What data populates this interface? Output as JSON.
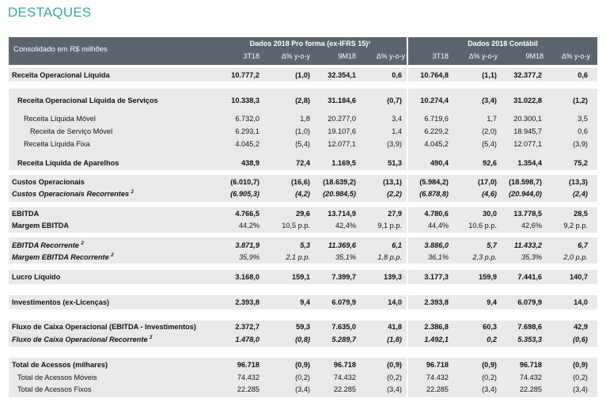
{
  "title": "DESTAQUES",
  "header": {
    "left_label": "Consolidado em R$ milhões",
    "group_proforma": "Dados 2018 Pro forma (ex-IFRS 15)¹",
    "group_contabil": "Dados 2018 Contábil",
    "columns": [
      "3T18",
      "∆% y-o-y",
      "9M18",
      "∆% y-o-y",
      "3T18",
      "∆% y-o-y",
      "9M18",
      "∆% y-o-y"
    ]
  },
  "rows": [
    {
      "label": "Receita Operacional Líquida",
      "values": [
        "10.777,2",
        "(1,0)",
        "32.354,1",
        "0,6",
        "10.764,8",
        "(1,1)",
        "32.377,2",
        "0,6"
      ]
    },
    {
      "label": "Receita Operacional Líquida de Serviços",
      "values": [
        "10.338,3",
        "(2,8)",
        "31.184,6",
        "(0,7)",
        "10.274,4",
        "(3,4)",
        "31.022,8",
        "(1,2)"
      ]
    },
    {
      "label": "Receita Líquida Móvel",
      "values": [
        "6.732,0",
        "1,8",
        "20.277,0",
        "3,4",
        "6.719,6",
        "1,7",
        "20.300,1",
        "3,5"
      ]
    },
    {
      "label": "Receita de Serviço Móvel",
      "values": [
        "6.293,1",
        "(1,0)",
        "19.107,6",
        "1,4",
        "6.229,2",
        "(2,0)",
        "18.945,7",
        "0,6"
      ]
    },
    {
      "label": "Receita Líquida Fixa",
      "values": [
        "4.045,2",
        "(5,4)",
        "12.077,1",
        "(3,9)",
        "4.045,2",
        "(5,4)",
        "12.077,1",
        "(3,9)"
      ]
    },
    {
      "label": "Receita Líquida de Aparelhos",
      "values": [
        "438,9",
        "72,4",
        "1.169,5",
        "51,3",
        "490,4",
        "92,6",
        "1.354,4",
        "75,2"
      ]
    },
    {
      "label": "Custos Operacionais",
      "values": [
        "(6.010,7)",
        "(16,6)",
        "(18.639,2)",
        "(13,1)",
        "(5.984,2)",
        "(17,0)",
        "(18.598,7)",
        "(13,3)"
      ]
    },
    {
      "label": "Custos Operacionais Recorrentes",
      "sup": "2",
      "values": [
        "(6.905,3)",
        "(4,2)",
        "(20.984,5)",
        "(2,2)",
        "(6.878,8)",
        "(4,6)",
        "(20.944,0)",
        "(2,4)"
      ]
    },
    {
      "label": "EBITDA",
      "values": [
        "4.766,5",
        "29,6",
        "13.714,9",
        "27,9",
        "4.780,6",
        "30,0",
        "13.778,5",
        "28,5"
      ]
    },
    {
      "label": "Margem EBITDA",
      "values": [
        "44,2%",
        "10,5 p.p.",
        "42,4%",
        "9,1 p.p.",
        "44,4%",
        "10,6 p.p.",
        "42,6%",
        "9,2 p.p."
      ]
    },
    {
      "label": "EBITDA Recorrente",
      "sup": "2",
      "values": [
        "3.871,9",
        "5,3",
        "11.369,6",
        "6,1",
        "3.886,0",
        "5,7",
        "11.433,2",
        "6,7"
      ]
    },
    {
      "label": "Margem EBITDA Recorrente",
      "sup": "2",
      "values": [
        "35,9%",
        "2,1 p.p.",
        "35,1%",
        "1,8 p.p.",
        "36,1%",
        "2,3 p.p.",
        "35,3%",
        "2,0 p.p."
      ]
    },
    {
      "label": "Lucro Líquido",
      "values": [
        "3.168,0",
        "159,1",
        "7.399,7",
        "139,3",
        "3.177,3",
        "159,9",
        "7.441,6",
        "140,7"
      ]
    },
    {
      "label": "Investimentos (ex-Licenças)",
      "values": [
        "2.393,8",
        "9,4",
        "6.079,9",
        "14,0",
        "2.393,8",
        "9,4",
        "6.079,9",
        "14,0"
      ]
    },
    {
      "label": "Fluxo de Caixa Operacional (EBITDA - Investimentos)",
      "values": [
        "2.372,7",
        "59,3",
        "7.635,0",
        "41,8",
        "2.386,8",
        "60,3",
        "7.698,6",
        "42,9"
      ]
    },
    {
      "label": "Fluxo de Caixa Operacional Recorrente",
      "sup": "2",
      "values": [
        "1.478,0",
        "(0,8)",
        "5.289,7",
        "(1,8)",
        "1.492,1",
        "0,2",
        "5.353,3",
        "(0,6)"
      ]
    },
    {
      "label": "Total de Acessos (milhares)",
      "values": [
        "96.718",
        "(0,9)",
        "96.718",
        "(0,9)",
        "96.718",
        "(0,9)",
        "96.718",
        "(0,9)"
      ]
    },
    {
      "label": "Total de Acessos Móveis",
      "values": [
        "74.432",
        "(0,2)",
        "74.432",
        "(0,2)",
        "74.432",
        "(0,2)",
        "74.432",
        "(0,2)"
      ]
    },
    {
      "label": "Total de Acessos Fixos",
      "values": [
        "22.285",
        "(3,4)",
        "22.285",
        "(3,4)",
        "22.285",
        "(3,4)",
        "22.285",
        "(3,4)"
      ]
    }
  ]
}
